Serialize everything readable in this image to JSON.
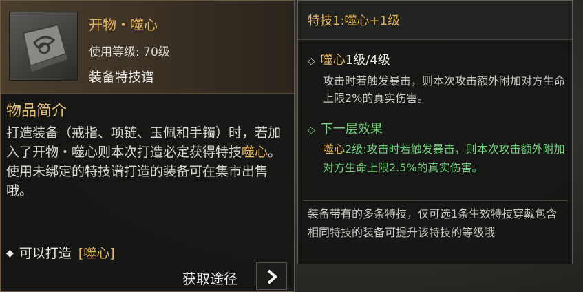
{
  "item": {
    "icon": "stone-tablet-icon",
    "name": "开物・噬心",
    "level": "使用等级: 70级",
    "type": "装备特技谱",
    "section_title": "物品简介",
    "desc_before": "打造装备（戒指、项链、玉佩和手镯）时，若加入了开物・噬心则本次打造必定获得特技",
    "desc_highlight": "噬心",
    "desc_after": "。使用未绑定的特技谱打造的装备可在集市出售哦。",
    "craft_label": "可以打造",
    "craft_tag": "[噬心]",
    "obtain_label": "获取途径"
  },
  "skill": {
    "title": "特技1:噬心+1级",
    "current_name": "噬心",
    "current_level": "1级/4级",
    "current_desc": "攻击时若触发暴击，则本次攻击额外附加对方生命上限2%的真实伤害。",
    "next_title": "下一层效果",
    "next_name": "噬心",
    "next_desc": "2级:攻击时若触发暴击，则本次攻击额外附加对方生命上限2.5%的真实伤害。",
    "note": "装备带有的多条特技，仅可选1条生效特技穿戴包含相同特技的装备可提升该特技的等级哦"
  },
  "colors": {
    "gold": "#e6b55c",
    "green": "#6ed07a",
    "text": "#d8d8d2"
  }
}
